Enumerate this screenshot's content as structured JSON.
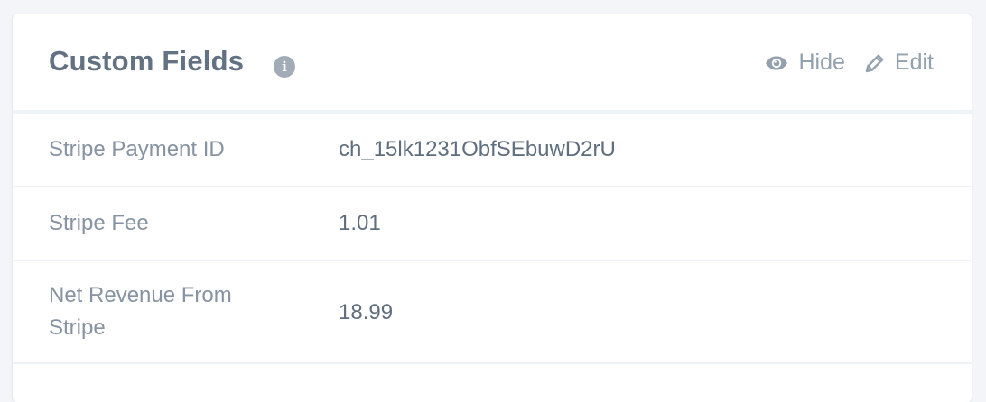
{
  "card": {
    "title": "Custom Fields",
    "info_icon": "info-circle-icon",
    "actions": {
      "hide": {
        "icon": "eye-icon",
        "label": "Hide"
      },
      "edit": {
        "icon": "pencil-icon",
        "label": "Edit"
      }
    }
  },
  "fields": [
    {
      "label": "Stripe Payment ID",
      "value": "ch_15lk1231ObfSEbuwD2rU"
    },
    {
      "label": "Stripe Fee",
      "value": "1.01"
    },
    {
      "label": "Net Revenue From Stripe",
      "value": "18.99"
    }
  ],
  "colors": {
    "title": "#627283",
    "label": "#8593a2",
    "value": "#5f6e7e",
    "action": "#93a0ad",
    "divider": "#eef1f5"
  }
}
